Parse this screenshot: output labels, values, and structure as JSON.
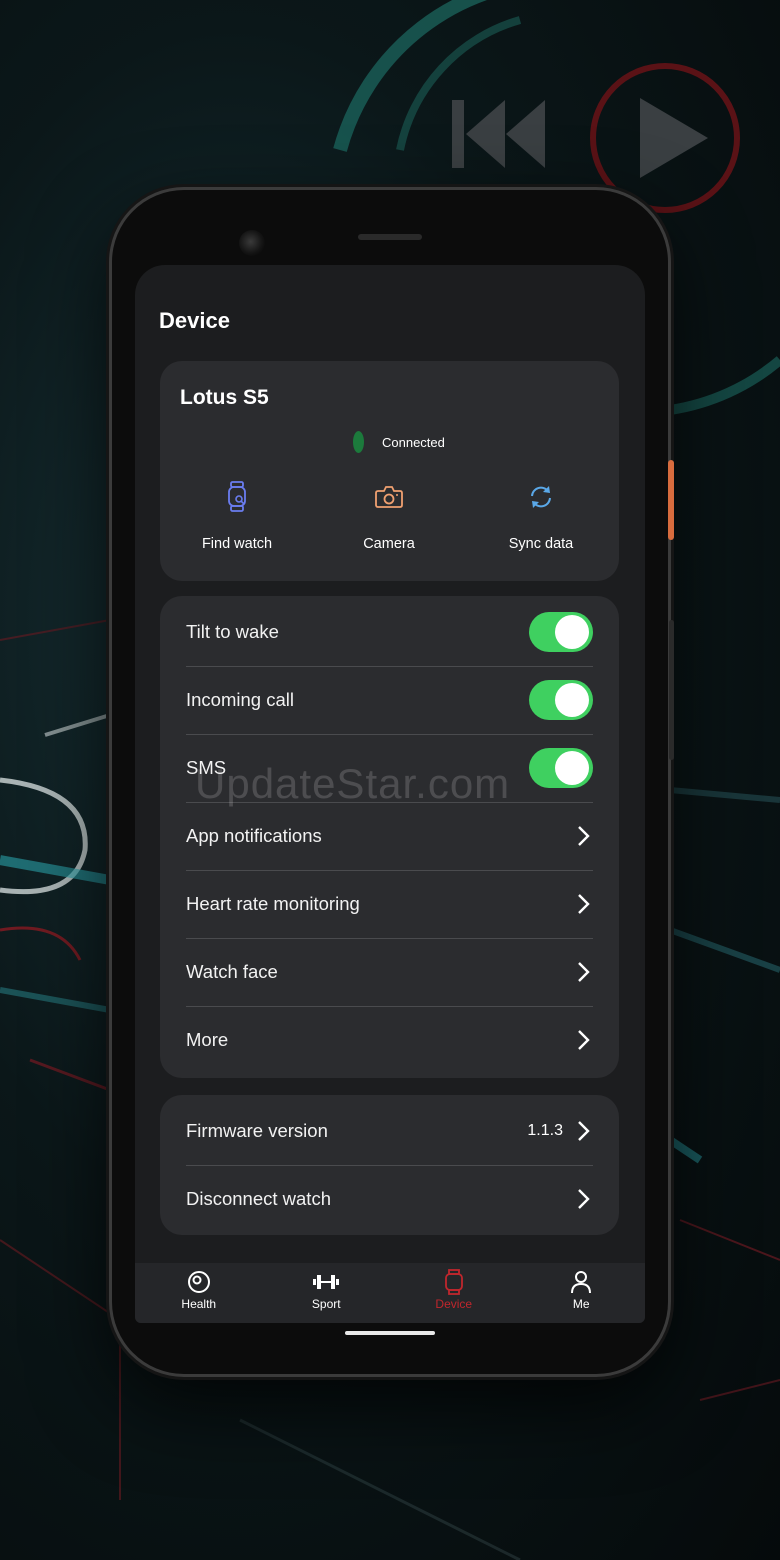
{
  "page": {
    "title": "Device"
  },
  "device": {
    "name": "Lotus S5",
    "status": "Connected",
    "actions": [
      {
        "label": "Find watch",
        "icon": "watch-icon",
        "color": "#6a7df0"
      },
      {
        "label": "Camera",
        "icon": "camera-icon",
        "color": "#f0a070"
      },
      {
        "label": "Sync data",
        "icon": "sync-icon",
        "color": "#5aa8e8"
      }
    ]
  },
  "settings": [
    {
      "label": "Tilt to wake",
      "type": "toggle",
      "on": true
    },
    {
      "label": "Incoming call",
      "type": "toggle",
      "on": true
    },
    {
      "label": "SMS",
      "type": "toggle",
      "on": true
    },
    {
      "label": "App notifications",
      "type": "link"
    },
    {
      "label": "Heart rate monitoring",
      "type": "link"
    },
    {
      "label": "Watch face",
      "type": "link"
    },
    {
      "label": "More",
      "type": "link"
    }
  ],
  "firmware": {
    "label": "Firmware version",
    "value": "1.1.3"
  },
  "disconnect": {
    "label": "Disconnect watch"
  },
  "nav": [
    {
      "label": "Health",
      "icon": "health-icon",
      "active": false
    },
    {
      "label": "Sport",
      "icon": "dumbbell-icon",
      "active": false
    },
    {
      "label": "Device",
      "icon": "watch-icon",
      "active": true
    },
    {
      "label": "Me",
      "icon": "person-icon",
      "active": false
    }
  ],
  "watermark": "UpdateStar.com",
  "colors": {
    "toggle_on": "#3fd060",
    "nav_active": "#c0262d",
    "card_bg": "#2b2c2f",
    "screen_bg": "#1c1d1f"
  }
}
